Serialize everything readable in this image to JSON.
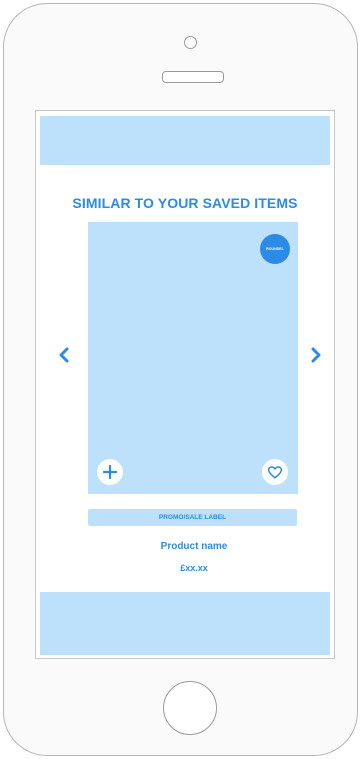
{
  "section": {
    "title": "SIMILAR TO YOUR SAVED ITEMS"
  },
  "carousel": {
    "prev_icon": "chevron-left-icon",
    "next_icon": "chevron-right-icon"
  },
  "product": {
    "badge": "ROUNDEL",
    "add_icon": "plus-icon",
    "save_icon": "heart-icon",
    "promo_label": "PROMO/SALE LABEL",
    "name": "Product name",
    "price": "£xx.xx"
  },
  "colors": {
    "accent": "#2b8be6",
    "placeholder": "#bde0fb",
    "frame": "#b5b5b5"
  }
}
